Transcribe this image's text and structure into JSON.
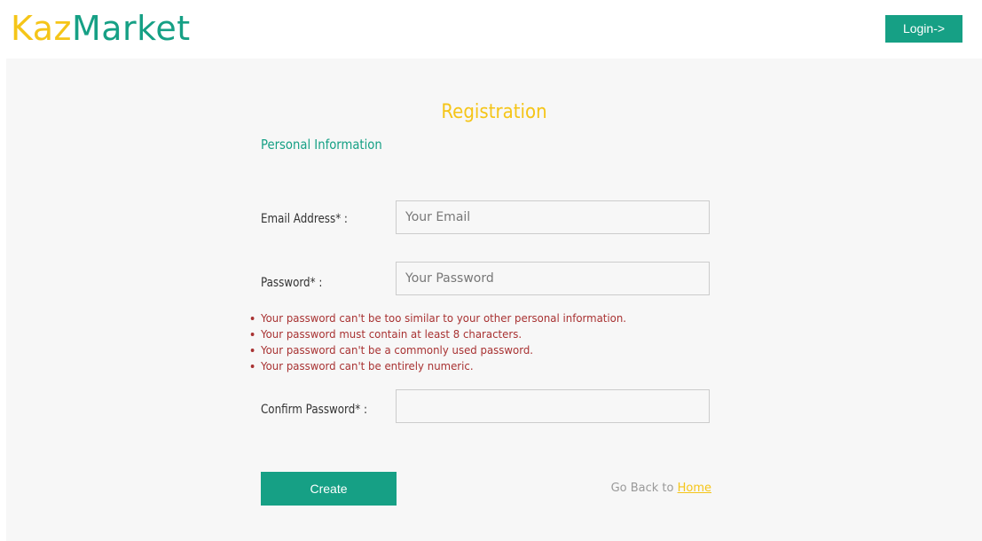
{
  "header": {
    "logo_part1": "Kaz",
    "logo_part2": "Market",
    "login_label": "Login->"
  },
  "form": {
    "title": "Registration",
    "section_title": "Personal Information",
    "email": {
      "label": "Email Address* :",
      "placeholder": "Your Email",
      "value": ""
    },
    "password": {
      "label": "Password* :",
      "placeholder": "Your Password",
      "value": ""
    },
    "confirm_password": {
      "label": "Confirm Password* :",
      "placeholder": "",
      "value": ""
    },
    "password_help": [
      "Your password can't be too similar to your other personal information.",
      "Your password must contain at least 8 characters.",
      "Your password can't be a commonly used password.",
      "Your password can't be entirely numeric."
    ],
    "create_label": "Create",
    "go_back_text": "Go Back to ",
    "home_link": "Home"
  },
  "colors": {
    "brand_green": "#16a085",
    "brand_yellow": "#f5c518",
    "error_red": "#a83232",
    "panel_bg": "#f7f7f7"
  }
}
